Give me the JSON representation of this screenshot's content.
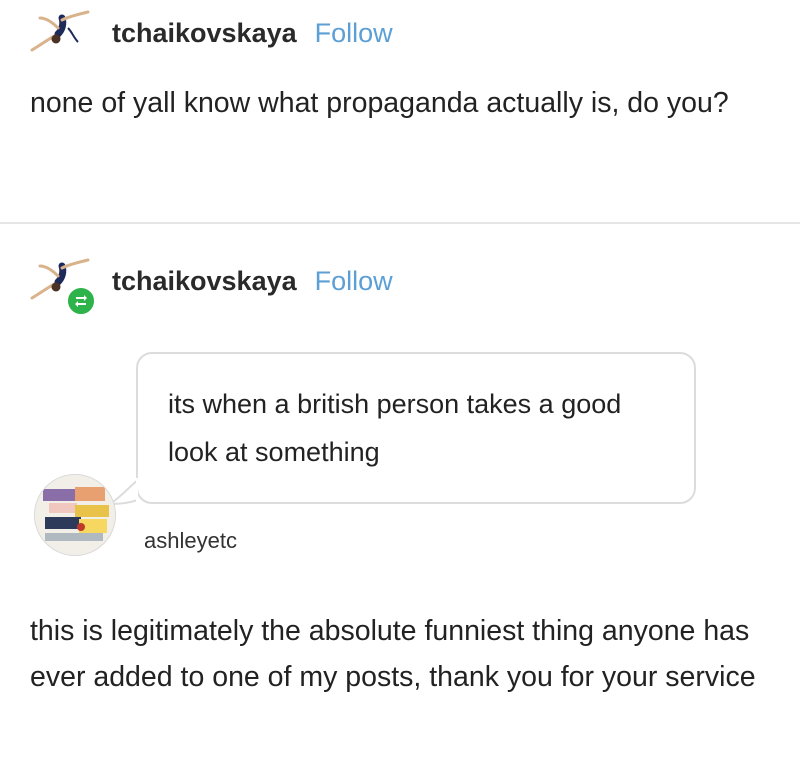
{
  "post": {
    "username": "tchaikovskaya",
    "follow_label": "Follow",
    "text": "none of yall know what propaganda actually is, do you?"
  },
  "reblog": {
    "username": "tchaikovskaya",
    "follow_label": "Follow",
    "ask": {
      "text": "its when a british person takes a good look at something",
      "asker": "ashleyetc"
    },
    "answer_text": "this is legitimately the absolute funniest thing anyone has ever added to one of my posts, thank you for your service"
  },
  "colors": {
    "follow": "#5b9fd6",
    "reblog_badge": "#2db34a",
    "divider": "#e6e6e6"
  },
  "icons": {
    "avatar": "gymnast-avatar",
    "reblog": "reblog-icon"
  }
}
